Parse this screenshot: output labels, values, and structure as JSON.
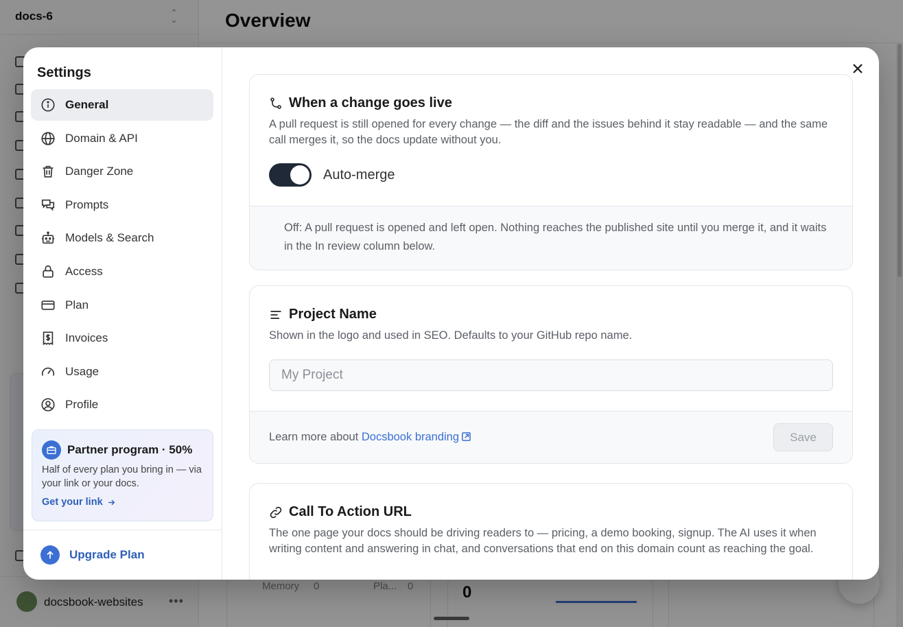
{
  "background": {
    "project_name": "docs-6",
    "page_title": "Overview",
    "workspace_name": "docsbook-websites",
    "stats": {
      "memory_label": "Memory",
      "memory_value": "0",
      "plan_label": "Pla...",
      "plan_value": "0",
      "big_value": "0"
    }
  },
  "settings": {
    "title": "Settings",
    "nav": [
      {
        "label": "General",
        "icon": "info-icon",
        "active": true
      },
      {
        "label": "Domain & API",
        "icon": "globe-icon"
      },
      {
        "label": "Danger Zone",
        "icon": "trash-icon"
      },
      {
        "label": "Prompts",
        "icon": "chat-bubbles-icon"
      },
      {
        "label": "Models & Search",
        "icon": "robot-icon"
      },
      {
        "label": "Access",
        "icon": "lock-icon"
      },
      {
        "label": "Plan",
        "icon": "credit-card-icon"
      },
      {
        "label": "Invoices",
        "icon": "receipt-icon"
      },
      {
        "label": "Usage",
        "icon": "gauge-icon"
      },
      {
        "label": "Profile",
        "icon": "user-circle-icon"
      }
    ],
    "partner": {
      "title": "Partner program · 50%",
      "description": "Half of every plan you bring in — via your link or your docs.",
      "link_label": "Get your link"
    },
    "upgrade_label": "Upgrade Plan"
  },
  "sections": {
    "go_live": {
      "title": "When a change goes live",
      "description": "A pull request is still opened for every change — the diff and the issues behind it stay readable — and the same call merges it, so the docs update without you.",
      "toggle_label": "Auto-merge",
      "toggle_on": true,
      "off_note": "Off: A pull request is opened and left open. Nothing reaches the published site until you merge it, and it waits in the In review column below."
    },
    "project_name": {
      "title": "Project Name",
      "description": "Shown in the logo and used in SEO. Defaults to your GitHub repo name.",
      "placeholder": "My Project",
      "learn_prefix": "Learn more about",
      "learn_link": "Docsbook branding",
      "save_label": "Save"
    },
    "cta_url": {
      "title": "Call To Action URL",
      "description": "The one page your docs should be driving readers to — pricing, a demo booking, signup. The AI uses it when writing content and answering in chat, and conversations that end on this domain count as reaching the goal."
    }
  },
  "colors": {
    "accent": "#3b6fd4",
    "toggle_on": "#1f2937",
    "active_nav": "#ebedf0"
  }
}
